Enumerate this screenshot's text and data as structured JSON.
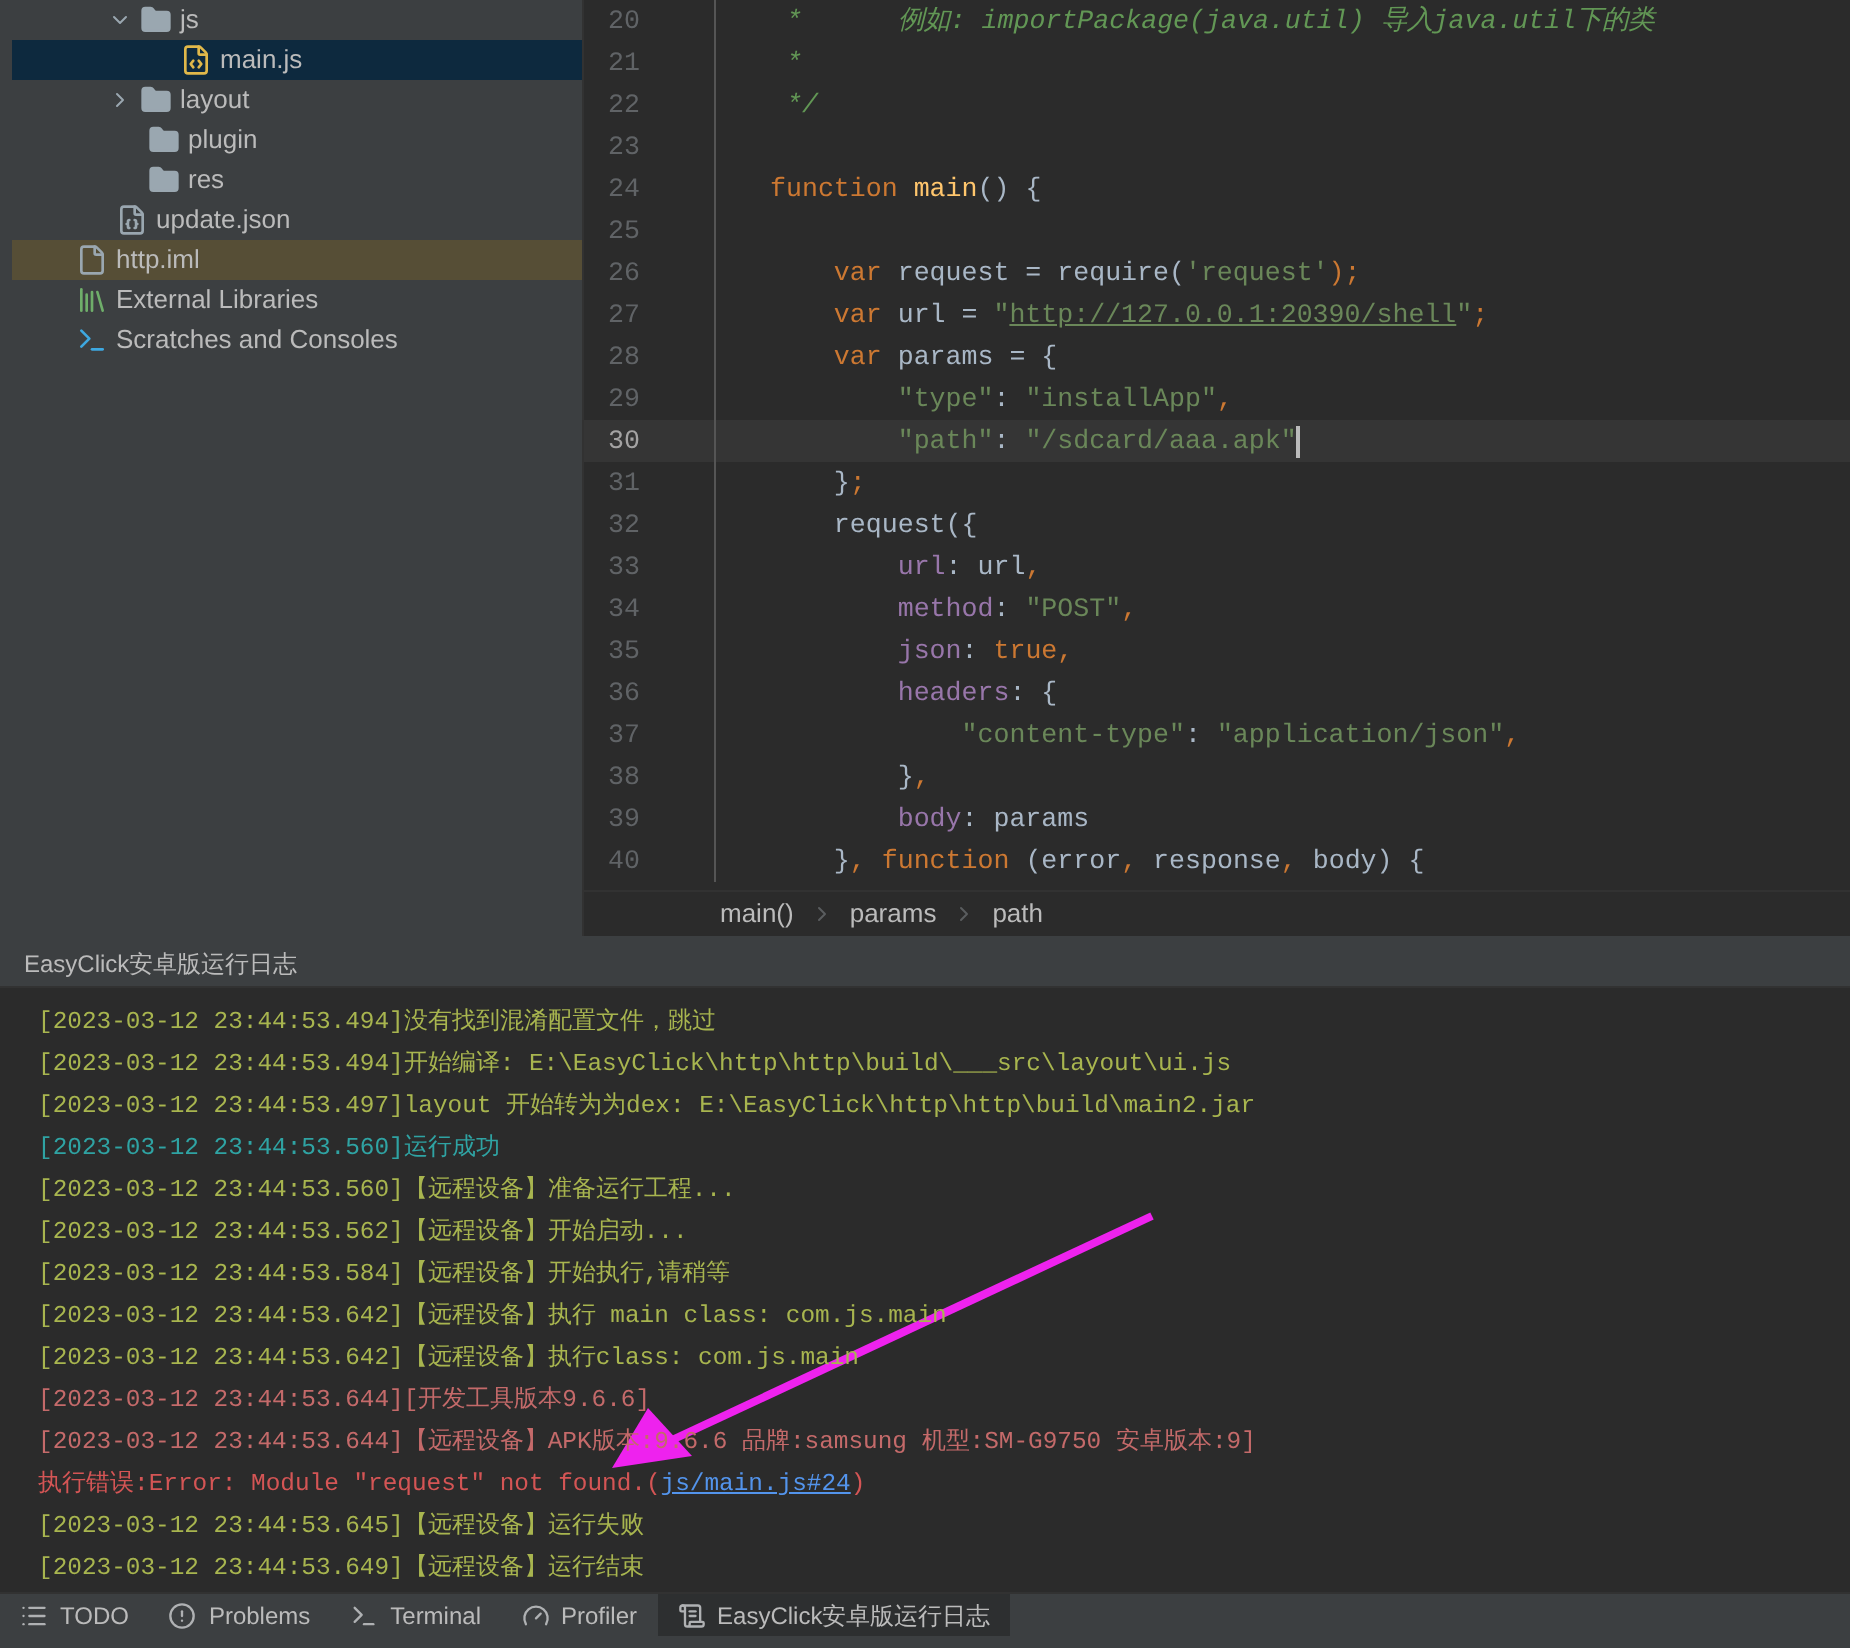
{
  "project_tree": {
    "folder_contents": [
      {
        "label": "js",
        "kind": "folder",
        "expanded": true,
        "selected": false,
        "children": [
          {
            "label": "main.js",
            "kind": "js-file",
            "selected": true
          }
        ]
      },
      {
        "label": "layout",
        "kind": "folder",
        "expanded": false,
        "selected": false
      },
      {
        "label": "plugin",
        "kind": "folder",
        "selected": false
      },
      {
        "label": "res",
        "kind": "folder",
        "selected": false
      },
      {
        "label": "update.json",
        "kind": "json-file",
        "selected": false
      }
    ],
    "items": [
      {
        "label": "http.iml",
        "kind": "iml-file",
        "selected": false,
        "highlighted": true
      },
      {
        "label": "External Libraries",
        "kind": "libraries",
        "selected": false,
        "highlighted": false
      },
      {
        "label": "Scratches and Consoles",
        "kind": "scratches",
        "selected": false,
        "highlighted": false
      }
    ]
  },
  "editor": {
    "lines": [
      {
        "number": "20",
        "current": false,
        "tokens": [
          {
            "kind": "comment",
            "text": " *      例如: importPackage(java.util) 导入java.util下的类"
          }
        ]
      },
      {
        "number": "21",
        "current": false,
        "tokens": [
          {
            "kind": "comment",
            "text": " *"
          }
        ]
      },
      {
        "number": "22",
        "current": false,
        "tokens": [
          {
            "kind": "comment",
            "text": " */"
          }
        ]
      },
      {
        "number": "23",
        "current": false
      },
      {
        "number": "24",
        "current": false,
        "tokens": [
          {
            "kind": "kw",
            "text": "function "
          },
          {
            "kind": "fn",
            "text": "main"
          },
          {
            "kind": "plain",
            "text": "() {"
          }
        ]
      },
      {
        "number": "25",
        "current": false
      },
      {
        "number": "26",
        "current": false,
        "tokens": [
          {
            "kind": "kw",
            "text": "    var"
          },
          {
            "kind": "plain",
            "text": " request = require("
          },
          {
            "kind": "str",
            "text": "'request'"
          },
          {
            "kind": "kw",
            "text": ");"
          }
        ]
      },
      {
        "number": "27",
        "current": false,
        "tokens": [
          {
            "kind": "kw",
            "text": "    var"
          },
          {
            "kind": "plain",
            "text": " url = "
          },
          {
            "kind": "str",
            "text": "\""
          },
          {
            "kind": "url",
            "text": "http://127.0.0.1:20390/shell"
          },
          {
            "kind": "str",
            "text": "\""
          },
          {
            "kind": "kw",
            "text": ";"
          }
        ]
      },
      {
        "number": "28",
        "current": false,
        "tokens": [
          {
            "kind": "kw",
            "text": "    var"
          },
          {
            "kind": "plain",
            "text": " params = {"
          }
        ]
      },
      {
        "number": "29",
        "current": false,
        "tokens": [
          {
            "kind": "str",
            "text": "        \"type\""
          },
          {
            "kind": "plain",
            "text": ": "
          },
          {
            "kind": "str",
            "text": "\"installApp\""
          },
          {
            "kind": "kw",
            "text": ","
          }
        ]
      },
      {
        "number": "30",
        "current": true,
        "tokens": [
          {
            "kind": "str",
            "text": "        \"path\""
          },
          {
            "kind": "plain",
            "text": ": "
          },
          {
            "kind": "str",
            "text": "\"/sdcard/aaa.apk\""
          }
        ]
      },
      {
        "number": "31",
        "current": false,
        "tokens": [
          {
            "kind": "plain",
            "text": "    }"
          },
          {
            "kind": "kw",
            "text": ";"
          }
        ]
      },
      {
        "number": "32",
        "current": false,
        "tokens": [
          {
            "kind": "plain",
            "text": "    request({"
          }
        ]
      },
      {
        "number": "33",
        "current": false,
        "tokens": [
          {
            "kind": "prop",
            "text": "        url"
          },
          {
            "kind": "plain",
            "text": ": url"
          },
          {
            "kind": "kw",
            "text": ","
          }
        ]
      },
      {
        "number": "34",
        "current": false,
        "tokens": [
          {
            "kind": "prop",
            "text": "        method"
          },
          {
            "kind": "plain",
            "text": ": "
          },
          {
            "kind": "str",
            "text": "\"POST\""
          },
          {
            "kind": "kw",
            "text": ","
          }
        ]
      },
      {
        "number": "35",
        "current": false,
        "tokens": [
          {
            "kind": "prop",
            "text": "        json"
          },
          {
            "kind": "plain",
            "text": ": "
          },
          {
            "kind": "kw",
            "text": "true,"
          }
        ]
      },
      {
        "number": "36",
        "current": false,
        "tokens": [
          {
            "kind": "prop",
            "text": "        headers"
          },
          {
            "kind": "plain",
            "text": ": {"
          }
        ]
      },
      {
        "number": "37",
        "current": false,
        "tokens": [
          {
            "kind": "str",
            "text": "            \"content-type\""
          },
          {
            "kind": "plain",
            "text": ": "
          },
          {
            "kind": "str",
            "text": "\"application/json\""
          },
          {
            "kind": "kw",
            "text": ","
          }
        ]
      },
      {
        "number": "38",
        "current": false,
        "tokens": [
          {
            "kind": "plain",
            "text": "        }"
          },
          {
            "kind": "kw",
            "text": ","
          }
        ]
      },
      {
        "number": "39",
        "current": false,
        "tokens": [
          {
            "kind": "prop",
            "text": "        body"
          },
          {
            "kind": "plain",
            "text": ": params"
          }
        ]
      },
      {
        "number": "40",
        "current": false,
        "tokens": [
          {
            "kind": "plain",
            "text": "    }"
          },
          {
            "kind": "kw",
            "text": ", function "
          },
          {
            "kind": "plain",
            "text": "(error"
          },
          {
            "kind": "kw",
            "text": ", "
          },
          {
            "kind": "plain",
            "text": "response"
          },
          {
            "kind": "kw",
            "text": ", "
          },
          {
            "kind": "plain",
            "text": "body) {"
          }
        ]
      }
    ]
  },
  "breadcrumbs": [
    "main()",
    "params",
    "path"
  ],
  "run_log": {
    "title": "EasyClick安卓版运行日志",
    "lines": [
      {
        "kind": "info",
        "text": "[2023-03-12 23:44:53.494]没有找到混淆配置文件，跳过"
      },
      {
        "kind": "info",
        "text": "[2023-03-12 23:44:53.494]开始编译: E:\\EasyClick\\http\\http\\build\\___src\\layout\\ui.js"
      },
      {
        "kind": "info",
        "text": "[2023-03-12 23:44:53.497]layout 开始转为为dex: E:\\EasyClick\\http\\http\\build\\main2.jar"
      },
      {
        "kind": "success",
        "text": "[2023-03-12 23:44:53.560]运行成功"
      },
      {
        "kind": "info",
        "text": "[2023-03-12 23:44:53.560]【远程设备】准备运行工程..."
      },
      {
        "kind": "info",
        "text": "[2023-03-12 23:44:53.562]【远程设备】开始启动..."
      },
      {
        "kind": "info",
        "text": "[2023-03-12 23:44:53.584]【远程设备】开始执行,请稍等"
      },
      {
        "kind": "info",
        "text": "[2023-03-12 23:44:53.642]【远程设备】执行 main class: com.js.main"
      },
      {
        "kind": "info",
        "text": "[2023-03-12 23:44:53.642]【远程设备】执行class: com.js.main"
      },
      {
        "kind": "version",
        "text": "[2023-03-12 23:44:53.644][开发工具版本9.6.6]"
      },
      {
        "kind": "version",
        "text": "[2023-03-12 23:44:53.644]【远程设备】APK版本:9.6.6 品牌:samsung 机型:SM-G9750 安卓版本:9]"
      },
      {
        "kind": "error",
        "text": "执行错误:Error: Module \"request\" not found.(",
        "link": "js/main.js#24 ",
        "after": ")"
      },
      {
        "kind": "info",
        "text": "[2023-03-12 23:44:53.645]【远程设备】运行失败"
      },
      {
        "kind": "info",
        "text": "[2023-03-12 23:44:53.649]【远程设备】运行结束"
      }
    ]
  },
  "tool_tabs": [
    {
      "label": "TODO",
      "kind": "todo",
      "selected": false
    },
    {
      "label": "Problems",
      "kind": "problems",
      "selected": false
    },
    {
      "label": "Terminal",
      "kind": "terminal",
      "selected": false
    },
    {
      "label": "Profiler",
      "kind": "profiler",
      "selected": false
    },
    {
      "label": "EasyClick安卓版运行日志",
      "kind": "log",
      "selected": true
    }
  ]
}
